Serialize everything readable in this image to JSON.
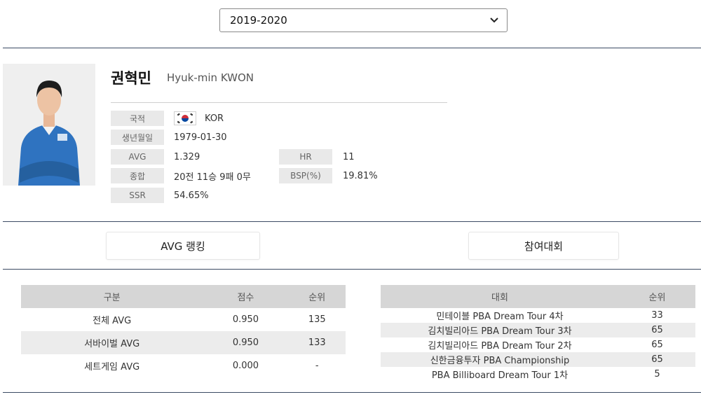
{
  "season_select": {
    "value": "2019-2020"
  },
  "player": {
    "name_kr": "권혁민",
    "name_en": "Hyuk-min KWON",
    "fields": {
      "nationality_label": "국적",
      "nationality": "KOR",
      "birth_label": "생년월일",
      "birth": "1979-01-30",
      "avg_label": "AVG",
      "avg": "1.329",
      "hr_label": "HR",
      "hr": "11",
      "record_label": "종합",
      "record": "20전 11승 9패 0무",
      "bsp_label": "BSP(%)",
      "bsp": "19.81%",
      "ssr_label": "SSR",
      "ssr": "54.65%"
    }
  },
  "tabs": {
    "avg_ranking": "AVG 랭킹",
    "tournaments": "참여대회"
  },
  "avg_table": {
    "headers": [
      "구분",
      "점수",
      "순위"
    ],
    "rows": [
      [
        "전체 AVG",
        "0.950",
        "135"
      ],
      [
        "서바이벌 AVG",
        "0.950",
        "133"
      ],
      [
        "세트게임 AVG",
        "0.000",
        "-"
      ]
    ]
  },
  "tournament_table": {
    "headers": [
      "대회",
      "순위"
    ],
    "rows": [
      [
        "민테이블 PBA Dream Tour 4차",
        "33"
      ],
      [
        "김치빌리아드 PBA Dream Tour 3차",
        "65"
      ],
      [
        "김치빌리아드 PBA Dream Tour 2차",
        "65"
      ],
      [
        "신한금융투자 PBA Championship",
        "65"
      ],
      [
        "PBA Billiboard Dream Tour 1차",
        "5"
      ]
    ]
  },
  "colors": {
    "divider": "#3b4a63",
    "label_bg": "#e9e9e9",
    "header_bg": "#d6d6d6",
    "stripe": "#ececec",
    "shirt": "#2f73c0"
  },
  "icons": {
    "select": "chevron-down-icon",
    "flag": "korea-flag-icon",
    "photo": "player-photo"
  }
}
